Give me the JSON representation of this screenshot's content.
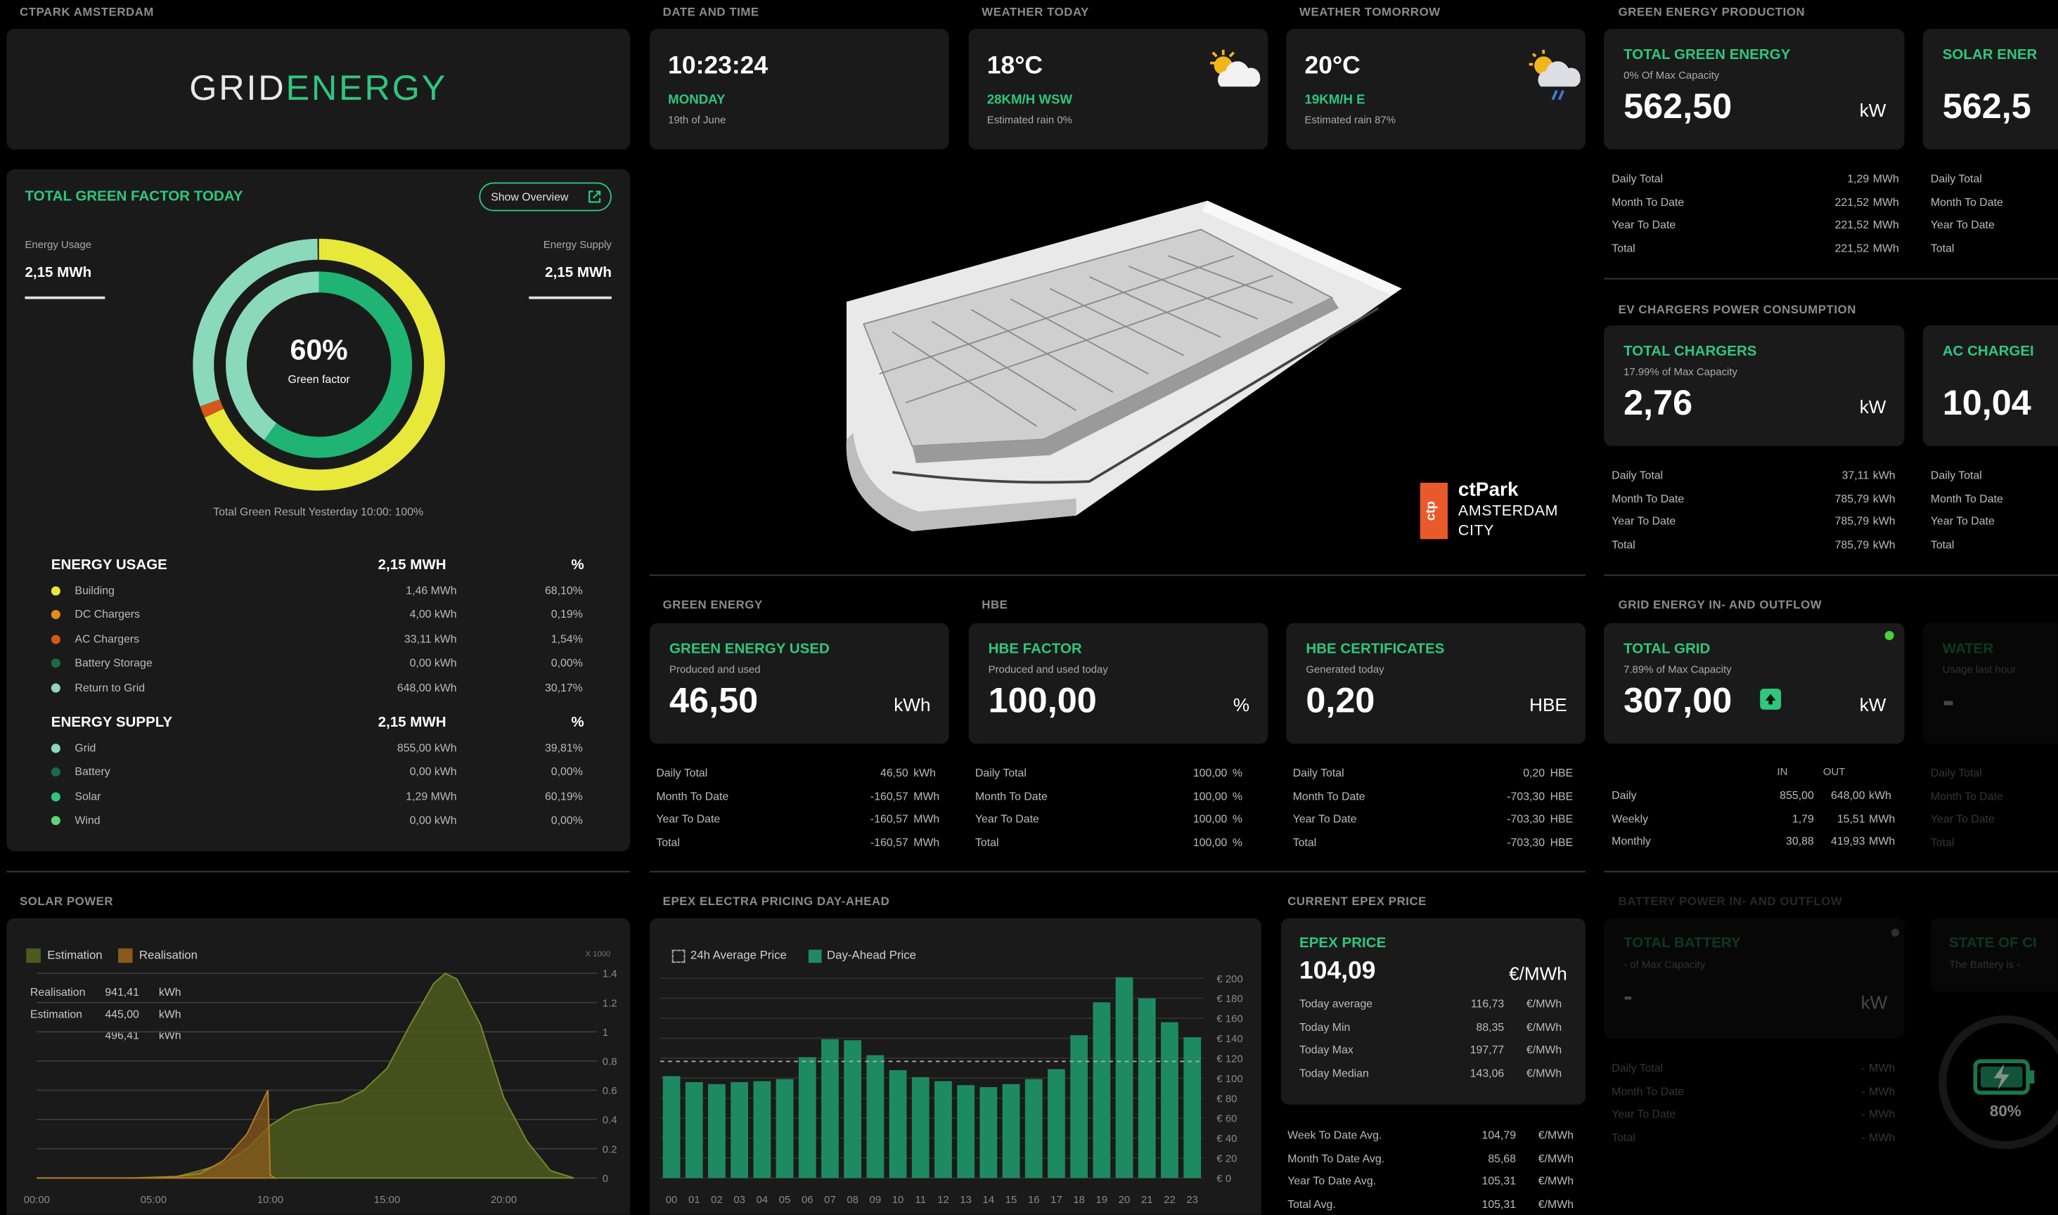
{
  "sections": {
    "ctpark": "CTPARK AMSTERDAM",
    "datetime": "DATE AND TIME",
    "weather_today": "WEATHER TODAY",
    "weather_tomorrow": "WEATHER TOMORROW",
    "green_production": "GREEN ENERGY PRODUCTION",
    "ev_chargers": "EV CHARGERS POWER CONSUMPTION",
    "green_energy": "GREEN ENERGY",
    "hbe": "HBE",
    "grid_inout": "GRID ENERGY IN- AND OUTFLOW",
    "solar_power": "SOLAR POWER",
    "epex_pricing": "EPEX ELECTRA PRICING DAY-AHEAD",
    "current_epex": "CURRENT EPEX PRICE",
    "battery": "BATTERY POWER IN- AND OUTFLOW"
  },
  "logo": {
    "part1": "GRID",
    "part2": "ENERGY"
  },
  "datetime": {
    "time": "10:23:24",
    "day": "MONDAY",
    "date": "19th of June"
  },
  "weather_today": {
    "temp": "18°C",
    "wind": "28KM/H WSW",
    "rain": "Estimated rain 0%",
    "icon": "partly-sunny-icon"
  },
  "weather_tomorrow": {
    "temp": "20°C",
    "wind": "19KM/H E",
    "rain": "Estimated rain 87%",
    "icon": "sun-cloud-rain-icon"
  },
  "green_factor": {
    "title": "TOTAL GREEN FACTOR TODAY",
    "button": "Show Overview",
    "usage_label": "Energy Usage",
    "usage_value": "2,15 MWh",
    "supply_label": "Energy Supply",
    "supply_value": "2,15 MWh",
    "percent": "60%",
    "caption": "Green factor",
    "percent_value": 0.6,
    "outer_segments": [
      {
        "name": "Building",
        "fraction": 0.681,
        "color": "#e7e83a"
      },
      {
        "name": "AC Chargers",
        "fraction": 0.0154,
        "color": "#d2581c"
      },
      {
        "name": "Return to Grid",
        "fraction": 0.3017,
        "color": "#8ad9bd"
      }
    ],
    "yesterday": "Total Green Result Yesterday 10:00: 100%",
    "usage_header": "ENERGY USAGE",
    "usage_total": "2,15 MWH",
    "pct": "%",
    "usage_rows": [
      {
        "name": "Building",
        "value": "1,46 MWh",
        "pct": "68,10%",
        "color": "#e7e83a"
      },
      {
        "name": "DC Chargers",
        "value": "4,00 kWh",
        "pct": "0,19%",
        "color": "#e58a1f"
      },
      {
        "name": "AC Chargers",
        "value": "33,11 kWh",
        "pct": "1,54%",
        "color": "#d2581c"
      },
      {
        "name": "Battery Storage",
        "value": "0,00 kWh",
        "pct": "0,00%",
        "color": "#1b6b4a"
      },
      {
        "name": "Return to Grid",
        "value": "648,00 kWh",
        "pct": "30,17%",
        "color": "#8ad9bd"
      }
    ],
    "supply_header": "ENERGY SUPPLY",
    "supply_total": "2,15 MWH",
    "supply_rows": [
      {
        "name": "Grid",
        "value": "855,00 kWh",
        "pct": "39,81%",
        "color": "#8ad9bd"
      },
      {
        "name": "Battery",
        "value": "0,00 kWh",
        "pct": "0,00%",
        "color": "#1b6b4a"
      },
      {
        "name": "Solar",
        "value": "1,29 MWh",
        "pct": "60,19%",
        "color": "#2ec77d"
      },
      {
        "name": "Wind",
        "value": "0,00 kWh",
        "pct": "0,00%",
        "color": "#5bd67a"
      }
    ]
  },
  "ctpark_logo": {
    "mark": "ctp",
    "name": "ctPark",
    "line1": "AMSTERDAM",
    "line2": "CITY"
  },
  "total_green": {
    "title": "TOTAL GREEN ENERGY",
    "sub": "0% Of Max Capacity",
    "value": "562,50",
    "unit": "kW",
    "rows": [
      {
        "label": "Daily Total",
        "value": "1,29",
        "unit": "MWh"
      },
      {
        "label": "Month To Date",
        "value": "221,52",
        "unit": "MWh"
      },
      {
        "label": "Year To Date",
        "value": "221,52",
        "unit": "MWh"
      },
      {
        "label": "Total",
        "value": "221,52",
        "unit": "MWh"
      }
    ]
  },
  "solar_energy": {
    "title": "SOLAR ENER",
    "value": "562,5",
    "rows": [
      {
        "label": "Daily Total"
      },
      {
        "label": "Month To Date"
      },
      {
        "label": "Year To Date"
      },
      {
        "label": "Total"
      }
    ]
  },
  "total_chargers": {
    "title": "TOTAL CHARGERS",
    "sub": "17.99% of Max Capacity",
    "value": "2,76",
    "unit": "kW",
    "rows": [
      {
        "label": "Daily Total",
        "value": "37,11",
        "unit": "kWh"
      },
      {
        "label": "Month To Date",
        "value": "785,79",
        "unit": "kWh"
      },
      {
        "label": "Year To Date",
        "value": "785,79",
        "unit": "kWh"
      },
      {
        "label": "Total",
        "value": "785,79",
        "unit": "kWh"
      }
    ]
  },
  "ac_chargers": {
    "title": "AC CHARGEI",
    "value": "10,04",
    "rows": [
      {
        "label": "Daily Total"
      },
      {
        "label": "Month To Date"
      },
      {
        "label": "Year To Date"
      },
      {
        "label": "Total"
      }
    ]
  },
  "green_used": {
    "title": "GREEN ENERGY USED",
    "sub": "Produced and used",
    "value": "46,50",
    "unit": "kWh",
    "rows": [
      {
        "label": "Daily Total",
        "value": "46,50",
        "unit": "kWh"
      },
      {
        "label": "Month To Date",
        "value": "-160,57",
        "unit": "MWh"
      },
      {
        "label": "Year To Date",
        "value": "-160,57",
        "unit": "MWh"
      },
      {
        "label": "Total",
        "value": "-160,57",
        "unit": "MWh"
      }
    ]
  },
  "hbe_factor": {
    "title": "HBE FACTOR",
    "sub": "Produced and used today",
    "value": "100,00",
    "unit": "%",
    "rows": [
      {
        "label": "Daily Total",
        "value": "100,00",
        "unit": "%"
      },
      {
        "label": "Month To Date",
        "value": "100,00",
        "unit": "%"
      },
      {
        "label": "Year To Date",
        "value": "100,00",
        "unit": "%"
      },
      {
        "label": "Total",
        "value": "100,00",
        "unit": "%"
      }
    ]
  },
  "hbe_certificates": {
    "title": "HBE CERTIFICATES",
    "sub": "Generated today",
    "value": "0,20",
    "unit": "HBE",
    "rows": [
      {
        "label": "Daily Total",
        "value": "0,20",
        "unit": "HBE"
      },
      {
        "label": "Month To Date",
        "value": "-703,30",
        "unit": "HBE"
      },
      {
        "label": "Year To Date",
        "value": "-703,30",
        "unit": "HBE"
      },
      {
        "label": "Total",
        "value": "-703,30",
        "unit": "HBE"
      }
    ]
  },
  "total_grid": {
    "title": "TOTAL GRID",
    "sub": "7.89% of Max Capacity",
    "value": "307,00",
    "unit": "kW",
    "in_label": "IN",
    "out_label": "OUT",
    "rows": [
      {
        "label": "Daily",
        "in": "855,00",
        "out": "648,00",
        "unit": "kWh"
      },
      {
        "label": "Weekly",
        "in": "1,79",
        "out": "15,51",
        "unit": "MWh"
      },
      {
        "label": "Monthly",
        "in": "30,88",
        "out": "419,93",
        "unit": "MWh"
      }
    ]
  },
  "water": {
    "title": "WATER",
    "sub": "Usage last hour",
    "value": "-",
    "rows": [
      {
        "label": "Daily Total"
      },
      {
        "label": "Month To Date"
      },
      {
        "label": "Year To Date"
      },
      {
        "label": "Total"
      }
    ]
  },
  "epex_price": {
    "title": "EPEX PRICE",
    "value": "104,09",
    "unit": "€/MWh",
    "rows": [
      {
        "label": "Today average",
        "value": "116,73",
        "unit": "€/MWh"
      },
      {
        "label": "Today Min",
        "value": "88,35",
        "unit": "€/MWh"
      },
      {
        "label": "Today Max",
        "value": "197,77",
        "unit": "€/MWh"
      },
      {
        "label": "Today Median",
        "value": "143,06",
        "unit": "€/MWh"
      }
    ],
    "avg_rows": [
      {
        "label": "Week To Date Avg.",
        "value": "104,79",
        "unit": "€/MWh"
      },
      {
        "label": "Month To Date Avg.",
        "value": "85,68",
        "unit": "€/MWh"
      },
      {
        "label": "Year To Date Avg.",
        "value": "105,31",
        "unit": "€/MWh"
      },
      {
        "label": "Total Avg.",
        "value": "105,31",
        "unit": "€/MWh"
      }
    ]
  },
  "total_battery": {
    "title": "TOTAL BATTERY",
    "sub": "- of Max Capacity",
    "value": "-",
    "unit": "kW",
    "rows": [
      {
        "label": "Daily Total",
        "value": "-",
        "unit": "MWh"
      },
      {
        "label": "Month To Date",
        "value": "-",
        "unit": "MWh"
      },
      {
        "label": "Year To Date",
        "value": "-",
        "unit": "MWh"
      },
      {
        "label": "Total",
        "value": "-",
        "unit": "MWh"
      }
    ]
  },
  "state_of_charge": {
    "title": "STATE OF CI",
    "sub": "The Battery is -",
    "value": "80%",
    "icon": "battery-charging-icon"
  },
  "solar_chart": {
    "legend_estimation": "Estimation",
    "legend_realisation": "Realisation",
    "realisation_label": "Realisation",
    "realisation_value": "941,41",
    "realisation_unit": "kWh",
    "estimation_label": "Estimation",
    "estimation_value": "445,00",
    "estimation_unit": "kWh",
    "third_value": "496,41",
    "third_unit": "kWh",
    "multiplier": "X 1000",
    "colors": {
      "estimation": "#4e5a1f",
      "realisation": "#8a5a1c"
    }
  },
  "epex_chart": {
    "legend_avg": "24h Average Price",
    "legend_day": "Day-Ahead Price",
    "bar_color": "#1e8a62"
  },
  "chart_data": [
    {
      "type": "area",
      "title": "SOLAR POWER",
      "x_ticks": [
        "00:00",
        "05:00",
        "10:00",
        "15:00",
        "20:00"
      ],
      "y_ticks": [
        "0",
        "0.2",
        "0.4",
        "0.6",
        "0.8",
        "1",
        "1.2",
        "1.4"
      ],
      "ylim": [
        0,
        1.4
      ],
      "xlim": [
        0,
        24
      ],
      "series": [
        {
          "name": "Estimation",
          "x": [
            0,
            4,
            6,
            7,
            8,
            9,
            10,
            11,
            12,
            13,
            14,
            15,
            16,
            17,
            17.5,
            18,
            19,
            20,
            21,
            22,
            23
          ],
          "values": [
            0,
            0,
            0.01,
            0.05,
            0.1,
            0.2,
            0.36,
            0.46,
            0.5,
            0.52,
            0.6,
            0.75,
            1.05,
            1.33,
            1.4,
            1.36,
            1.05,
            0.55,
            0.25,
            0.05,
            0
          ]
        },
        {
          "name": "Realisation",
          "x": [
            0,
            5,
            6,
            7,
            8,
            9,
            9.9,
            10,
            10.2
          ],
          "values": [
            0,
            0,
            0.01,
            0.03,
            0.12,
            0.3,
            0.6,
            0.02,
            0
          ]
        }
      ],
      "grid": true
    },
    {
      "type": "bar",
      "title": "EPEX ELECTRA PRICING DAY-AHEAD",
      "categories": [
        "00",
        "01",
        "02",
        "03",
        "04",
        "05",
        "06",
        "07",
        "08",
        "09",
        "10",
        "11",
        "12",
        "13",
        "14",
        "15",
        "16",
        "17",
        "18",
        "19",
        "20",
        "21",
        "22",
        "23"
      ],
      "y_ticks": [
        "€ 0",
        "€ 20",
        "€ 40",
        "€ 60",
        "€ 80",
        "€ 100",
        "€ 120",
        "€ 140",
        "€ 160",
        "€ 180",
        "€ 200"
      ],
      "ylim": [
        0,
        205
      ],
      "series": [
        {
          "name": "Day-Ahead Price",
          "values": [
            102,
            96,
            94,
            96,
            97,
            99,
            121,
            139,
            138,
            123,
            108,
            101,
            97,
            93,
            91,
            94,
            99,
            109,
            143,
            176,
            201,
            180,
            156,
            141
          ]
        },
        {
          "name": "24h Average Price",
          "values": [
            116.73
          ]
        }
      ],
      "legend": "top-left"
    }
  ]
}
